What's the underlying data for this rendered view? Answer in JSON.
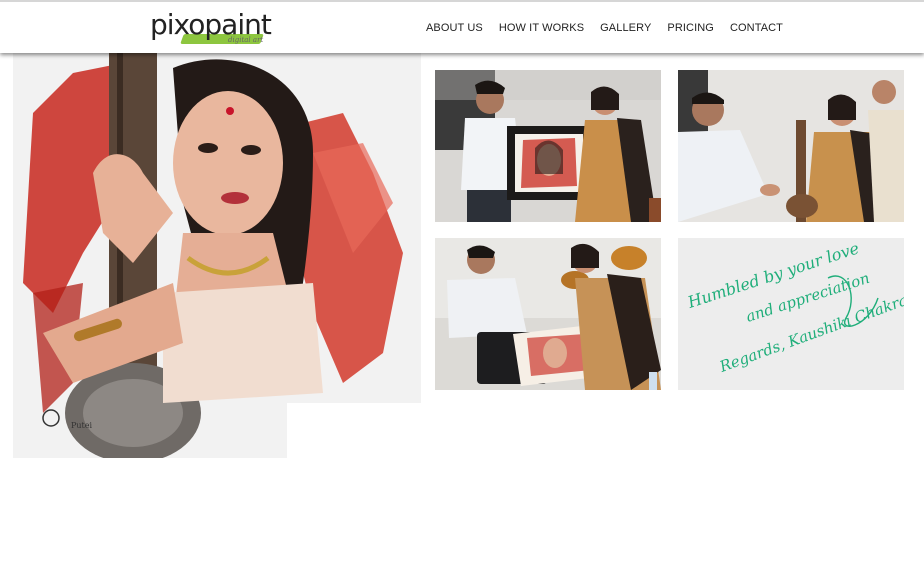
{
  "brand": {
    "name_part1": "pixo",
    "name_part2": "paint",
    "tagline": "digital art"
  },
  "nav": {
    "items": [
      {
        "label": "ABOUT US"
      },
      {
        "label": "HOW IT WORKS"
      },
      {
        "label": "GALLERY"
      },
      {
        "label": "PRICING"
      },
      {
        "label": "CONTACT"
      }
    ]
  },
  "note": {
    "line1": "Humbled by your love",
    "line2": "and appreciation",
    "line3": "Regards, Kaushiki Chakraborty"
  },
  "colors": {
    "accent_green": "#8dc63f",
    "note_ink": "#1fae7a",
    "paint_red": "#c8281e"
  }
}
